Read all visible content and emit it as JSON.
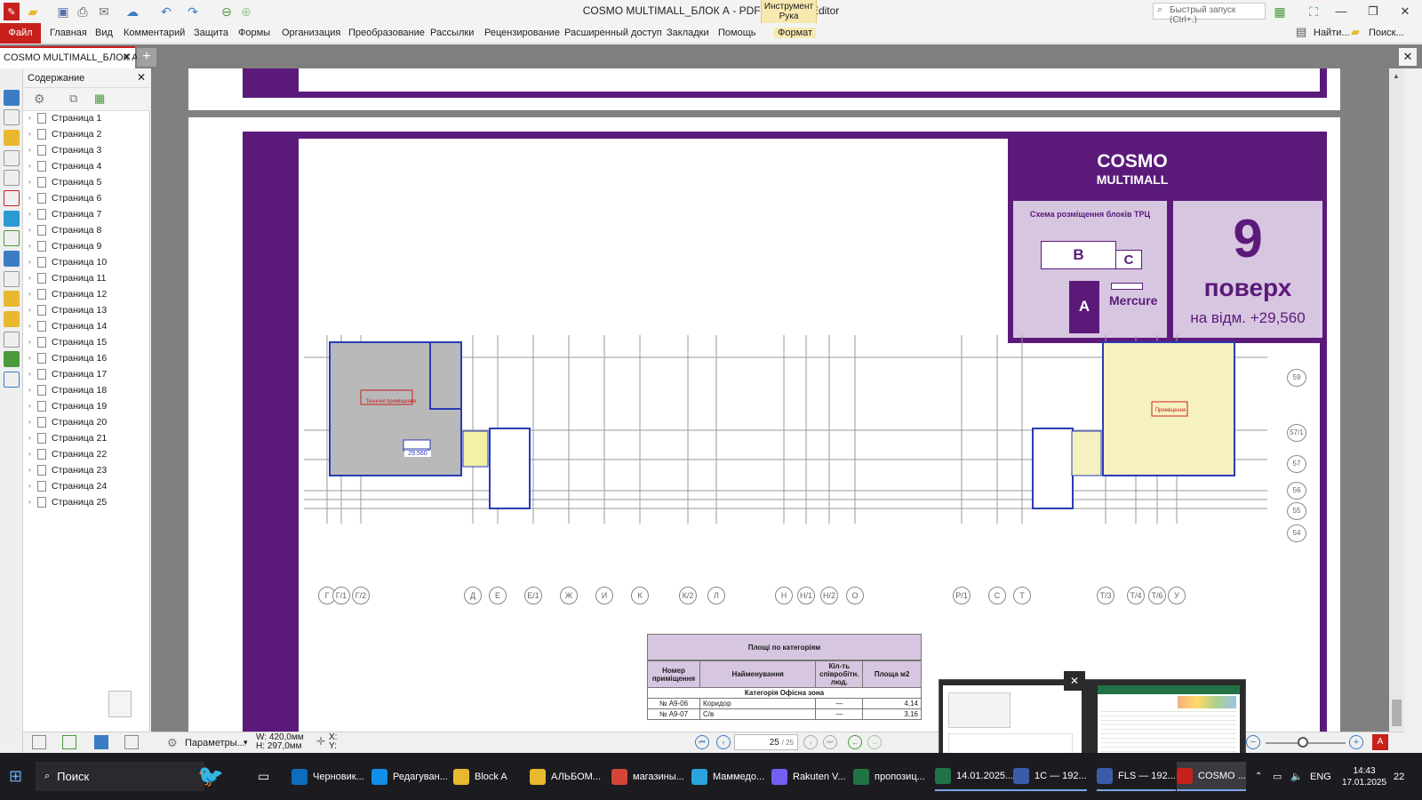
{
  "window": {
    "title": "COSMO MULTIMALL_БЛОК А - PDF-XChange Editor",
    "context_tab_group": "Инструмент Рука",
    "context_tab": "Формат",
    "quick_launch_placeholder": "Быстрый запуск (Ctrl+.)",
    "find_label": "Найти...",
    "search_label": "Поиск..."
  },
  "menu": {
    "file": "Файл",
    "items": [
      "Главная",
      "Вид",
      "Комментарий",
      "Защита",
      "Формы",
      "Организация",
      "Преобразование",
      "Рассылки",
      "Рецензирование",
      "Расширенный доступ",
      "Закладки",
      "Помощь"
    ]
  },
  "doc_tab": {
    "label": "COSMO MULTIMALL_БЛОК А"
  },
  "bookmarks": {
    "title": "Содержание",
    "items": [
      "Страница 1",
      "Страница 2",
      "Страница 3",
      "Страница 4",
      "Страница 5",
      "Страница 6",
      "Страница 7",
      "Страница 8",
      "Страница 9",
      "Страница 10",
      "Страница 11",
      "Страница 12",
      "Страница 13",
      "Страница 14",
      "Страница 15",
      "Страница 16",
      "Страница 17",
      "Страница 18",
      "Страница 19",
      "Страница 20",
      "Страница 21",
      "Страница 22",
      "Страница 23",
      "Страница 24",
      "Страница 25"
    ]
  },
  "drawing": {
    "brand_1": "COSMO",
    "brand_2": "MULTIMALL",
    "scheme_title": "Схема розміщення блоків ТРЦ",
    "block_b": "B",
    "block_c": "C",
    "block_a": "A",
    "mercure": "Mercure",
    "floor_number": "9",
    "floor_word": "поверх",
    "floor_elevation": "на відм. +29,560",
    "level_mark": "29.560",
    "room_label_left": "Технічні приміщення",
    "room_label_right": "Приміщення",
    "grid_bottom": [
      "Г",
      "Г/1",
      "Г/2",
      "Д",
      "Е",
      "Е/1",
      "Ж",
      "И",
      "К",
      "К/2",
      "Л",
      "Н",
      "Н/1",
      "Н/2",
      "О",
      "Р/1",
      "С",
      "Т",
      "Т/3",
      "Т/4",
      "Т/6",
      "У"
    ],
    "grid_right": [
      "59",
      "57/1",
      "57",
      "56",
      "55",
      "54"
    ],
    "table": {
      "title": "Площі по категоріям",
      "headers": [
        "Номер приміщення",
        "Найменування",
        "Кіл-ть співробітн. люд.",
        "Площа м2"
      ],
      "category": "Категорія Офісна зона",
      "rows": [
        [
          "№ А9-06",
          "Коридор",
          "—",
          "4,14"
        ],
        [
          "№ А9-07",
          "С/в",
          "—",
          "3,16"
        ]
      ]
    }
  },
  "status": {
    "options_label": "Параметры...",
    "width": "W: 420,0мм",
    "height": "H: 297,0мм",
    "x_label": "X:",
    "y_label": "Y:",
    "current_page": "25",
    "total_pages": "/ 25"
  },
  "taskbar": {
    "search": "Поиск",
    "apps": [
      "Черновик...",
      "Редагуван...",
      "Block A",
      "АЛЬБОМ...",
      "магазины...",
      "Маммедо...",
      "Rakuten V...",
      "пропозиц...",
      "14.01.2025...",
      "1С — 192...",
      "FLS — 192...",
      "COSMO ..."
    ],
    "lang": "ENG",
    "time": "14:43",
    "date": "17.01.2025",
    "notif_count": "22"
  }
}
